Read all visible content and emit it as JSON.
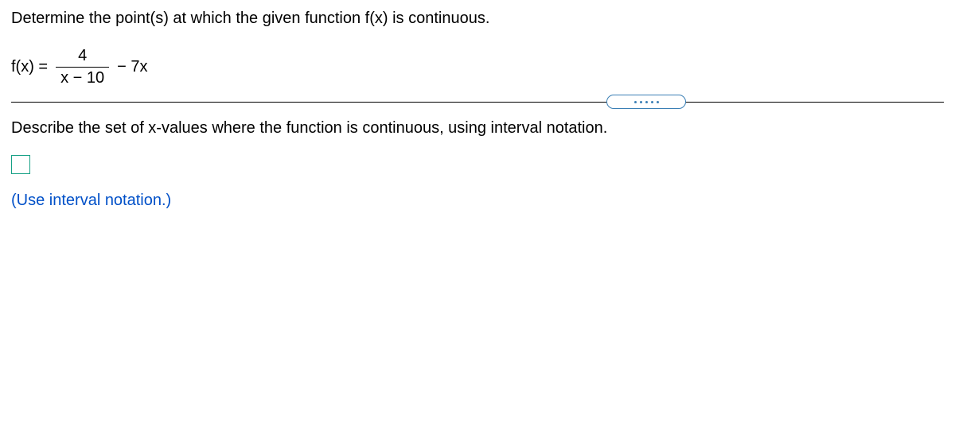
{
  "question": {
    "prompt": "Determine the point(s) at which the given function f(x) is continuous.",
    "equation": {
      "lhs": "f(x) =",
      "fraction_num": "4",
      "fraction_den": "x − 10",
      "tail": "− 7x"
    },
    "sub_prompt": "Describe the set of x-values where the function is continuous, using interval notation.",
    "hint": "(Use interval notation.)"
  }
}
